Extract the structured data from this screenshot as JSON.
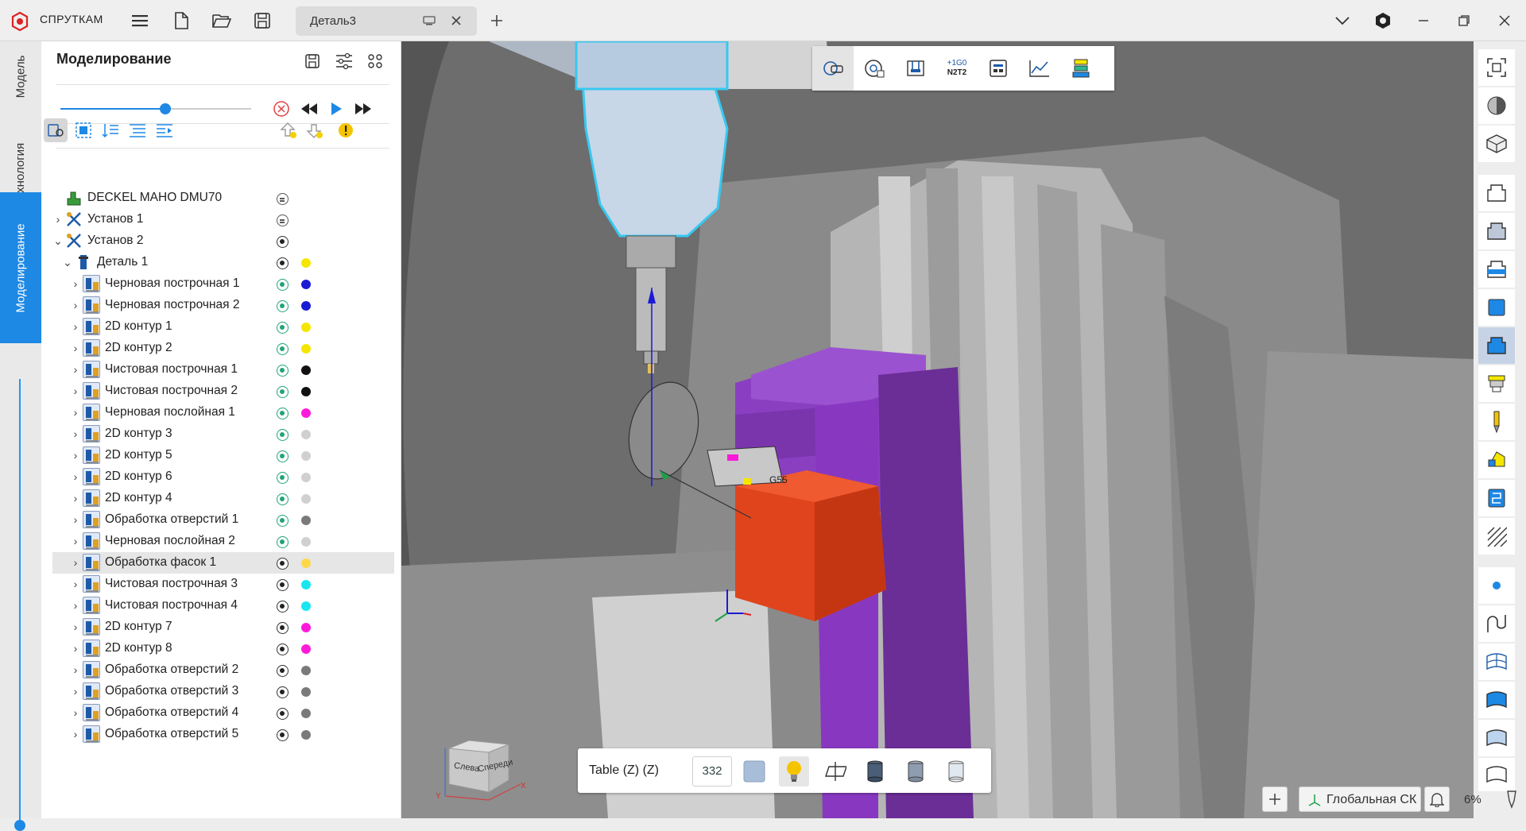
{
  "titlebar": {
    "app_name": "СПРУТКАМ",
    "tab_label": "Деталь3"
  },
  "vtabs": {
    "model": "Модель",
    "technology": "Технология",
    "modeling": "Моделирование"
  },
  "panel": {
    "title": "Моделирование",
    "slider_value": 0.55
  },
  "tree": [
    {
      "label": "DECKEL MAHO DMU70",
      "level": 0,
      "expander": false,
      "icon": "machine-icon",
      "status": "gray",
      "dot": ""
    },
    {
      "label": "Установ 1",
      "level": 0,
      "expander": true,
      "expanded": false,
      "icon": "setup-icon",
      "status": "gray",
      "dot": ""
    },
    {
      "label": "Установ 2",
      "level": 0,
      "expander": true,
      "expanded": true,
      "icon": "setup-icon",
      "status": "black",
      "dot": ""
    },
    {
      "label": "Деталь 1",
      "level": 1,
      "expander": true,
      "expanded": true,
      "icon": "part-icon",
      "status": "black",
      "dot": "#f5e600"
    },
    {
      "label": "Черновая построчная 1",
      "level": 2,
      "expander": true,
      "icon": "operation-icon",
      "status": "green",
      "dot": "#1a1ad6"
    },
    {
      "label": "Черновая построчная 2",
      "level": 2,
      "expander": true,
      "icon": "operation-icon",
      "status": "green",
      "dot": "#1a1ad6"
    },
    {
      "label": "2D контур 1",
      "level": 2,
      "expander": true,
      "icon": "operation-icon",
      "status": "green",
      "dot": "#f5e600"
    },
    {
      "label": "2D контур 2",
      "level": 2,
      "expander": true,
      "icon": "operation-icon",
      "status": "green",
      "dot": "#f5e600"
    },
    {
      "label": "Чистовая построчная 1",
      "level": 2,
      "expander": true,
      "icon": "operation-icon",
      "status": "green",
      "dot": "#111111"
    },
    {
      "label": "Чистовая построчная 2",
      "level": 2,
      "expander": true,
      "icon": "operation-icon",
      "status": "green",
      "dot": "#111111"
    },
    {
      "label": "Черновая послойная 1",
      "level": 2,
      "expander": true,
      "icon": "operation-icon",
      "status": "green",
      "dot": "#ff1ad9"
    },
    {
      "label": "2D контур 3",
      "level": 2,
      "expander": true,
      "icon": "operation-icon",
      "status": "green",
      "dot": "#d0d0d0"
    },
    {
      "label": "2D контур 5",
      "level": 2,
      "expander": true,
      "icon": "operation-icon",
      "status": "green",
      "dot": "#d0d0d0"
    },
    {
      "label": "2D контур 6",
      "level": 2,
      "expander": true,
      "icon": "operation-icon",
      "status": "green",
      "dot": "#d0d0d0"
    },
    {
      "label": "2D контур 4",
      "level": 2,
      "expander": true,
      "icon": "operation-icon",
      "status": "green",
      "dot": "#d0d0d0"
    },
    {
      "label": "Обработка отверстий 1",
      "level": 2,
      "expander": true,
      "icon": "operation-icon",
      "status": "green",
      "dot": "#7a7a7a"
    },
    {
      "label": "Черновая послойная 2",
      "level": 2,
      "expander": true,
      "icon": "operation-icon",
      "status": "green",
      "dot": "#d0d0d0"
    },
    {
      "label": "Обработка фасок 1",
      "level": 2,
      "expander": true,
      "icon": "operation-icon",
      "status": "black",
      "dot": "#ffd84a",
      "selected": true
    },
    {
      "label": "Чистовая построчная 3",
      "level": 2,
      "expander": true,
      "icon": "operation-icon",
      "status": "black",
      "dot": "#19e6f0"
    },
    {
      "label": "Чистовая построчная 4",
      "level": 2,
      "expander": true,
      "icon": "operation-icon",
      "status": "black",
      "dot": "#19e6f0"
    },
    {
      "label": "2D контур 7",
      "level": 2,
      "expander": true,
      "icon": "operation-icon",
      "status": "black",
      "dot": "#ff1ad9"
    },
    {
      "label": "2D контур 8",
      "level": 2,
      "expander": true,
      "icon": "operation-icon",
      "status": "black",
      "dot": "#ff1ad9"
    },
    {
      "label": "Обработка отверстий 2",
      "level": 2,
      "expander": true,
      "icon": "operation-icon",
      "status": "black",
      "dot": "#7a7a7a"
    },
    {
      "label": "Обработка отверстий 3",
      "level": 2,
      "expander": true,
      "icon": "operation-icon",
      "status": "black",
      "dot": "#7a7a7a"
    },
    {
      "label": "Обработка отверстий 4",
      "level": 2,
      "expander": true,
      "icon": "operation-icon",
      "status": "black",
      "dot": "#7a7a7a"
    },
    {
      "label": "Обработка отверстий 5",
      "level": 2,
      "expander": true,
      "icon": "operation-icon",
      "status": "black",
      "dot": "#7a7a7a"
    }
  ],
  "viewport": {
    "toolbar_gcode_label_top": "+1G0",
    "toolbar_gcode_label_bottom": "N2T2",
    "workpiece_label": "G55",
    "view_cube_left": "Слева",
    "view_cube_front": "Спереди",
    "axis_x": "X",
    "axis_y": "Y"
  },
  "bottom_toolbar": {
    "label": "Table (Z) (Z)",
    "value": "332"
  },
  "status": {
    "coordinate_system": "Глобальная СК",
    "zoom": "6%"
  },
  "colors": {
    "accent": "#1e88e5",
    "fixture_purple": "#8a3fc0",
    "vise_orange": "#e0441c",
    "spindle_outline": "#38c8f0"
  }
}
